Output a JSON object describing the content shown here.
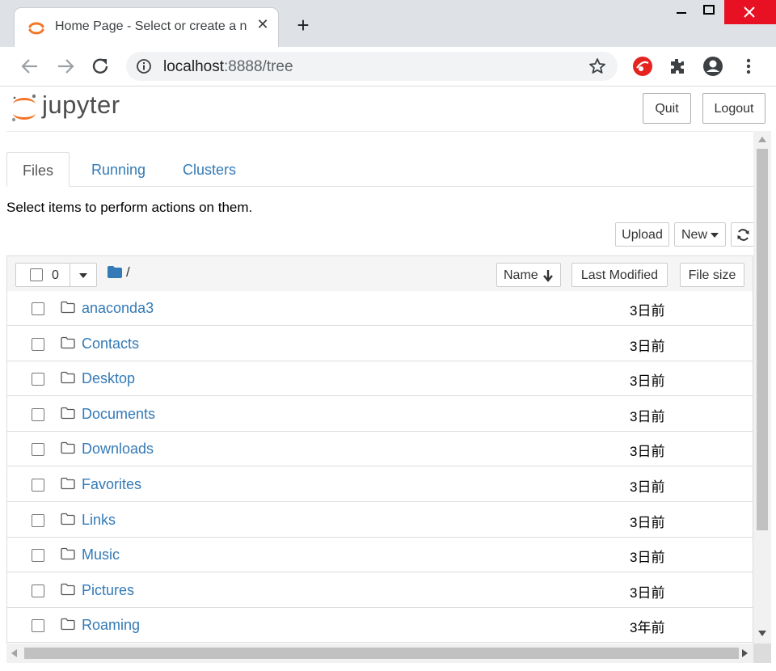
{
  "browser": {
    "tab_title": "Home Page - Select or create a notebook",
    "new_tab_symbol": "+",
    "close_tab_symbol": "✕",
    "url_host": "localhost",
    "url_path": ":8888/tree"
  },
  "header": {
    "logo_text": "jupyter",
    "quit_label": "Quit",
    "logout_label": "Logout"
  },
  "tabs": [
    {
      "label": "Files"
    },
    {
      "label": "Running"
    },
    {
      "label": "Clusters"
    }
  ],
  "instructions": "Select items to perform actions on them.",
  "toolbar": {
    "upload_label": "Upload",
    "new_label": "New"
  },
  "list_header": {
    "selected_count": "0",
    "path": "/",
    "sort_name_label": "Name",
    "sort_modified_label": "Last Modified",
    "sort_size_label": "File size"
  },
  "items": [
    {
      "name": "anaconda3",
      "modified": "3日前"
    },
    {
      "name": "Contacts",
      "modified": "3日前"
    },
    {
      "name": "Desktop",
      "modified": "3日前"
    },
    {
      "name": "Documents",
      "modified": "3日前"
    },
    {
      "name": "Downloads",
      "modified": "3日前"
    },
    {
      "name": "Favorites",
      "modified": "3日前"
    },
    {
      "name": "Links",
      "modified": "3日前"
    },
    {
      "name": "Music",
      "modified": "3日前"
    },
    {
      "name": "Pictures",
      "modified": "3日前"
    },
    {
      "name": "Roaming",
      "modified": "3年前"
    }
  ],
  "colors": {
    "link": "#337ab7",
    "jupyter_orange": "#f37626",
    "extension_red": "#e52420"
  }
}
